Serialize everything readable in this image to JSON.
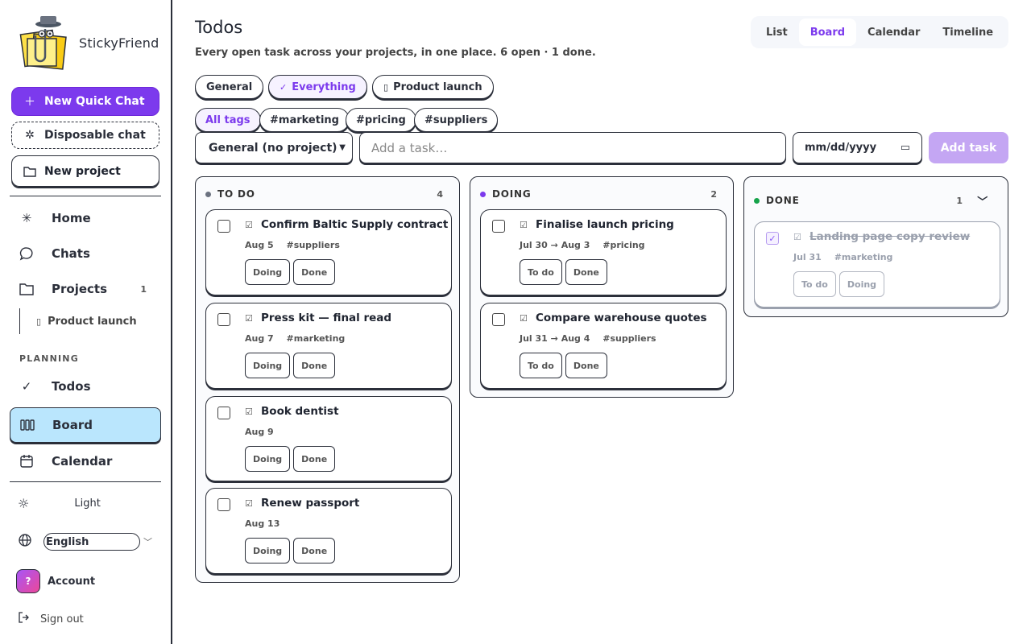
{
  "app": {
    "name": "StickyFriend"
  },
  "sidebar": {
    "new_quick_chat": "New Quick Chat",
    "disposable_chat": "Disposable chat",
    "new_project": "New project",
    "nav": {
      "home": "Home",
      "chats": "Chats",
      "projects": "Projects",
      "projects_count": "1",
      "project_child": "Product launch"
    },
    "planning_label": "PLANNING",
    "planning": {
      "todos": "Todos",
      "board": "Board",
      "calendar": "Calendar"
    },
    "theme": "Light",
    "language": "English",
    "account": "Account",
    "avatar_initial": "?",
    "sign_out": "Sign out"
  },
  "header": {
    "title": "Todos",
    "subtitle": "Every open task across your projects, in one place. 6 open · 1 done."
  },
  "views": {
    "list": "List",
    "board": "Board",
    "calendar": "Calendar",
    "timeline": "Timeline",
    "active": "Board"
  },
  "project_filters": {
    "general": "General",
    "everything": "Everything",
    "product_launch": "Product launch"
  },
  "tag_filters": {
    "all": "All tags",
    "marketing": "#marketing",
    "pricing": "#pricing",
    "suppliers": "#suppliers"
  },
  "composer": {
    "project_select": "General (no project)",
    "task_placeholder": "Add a task…",
    "date_placeholder": "mm/dd/yyyy",
    "add_button": "Add task"
  },
  "colors": {
    "accent": "#7c3aed",
    "todo_dot": "#6b7280",
    "doing_dot": "#7c3aed",
    "done_dot": "#16a34a",
    "active_nav": "#bae6fd"
  },
  "columns": {
    "todo": {
      "label": "TO DO",
      "count": "4",
      "cards": [
        {
          "title": "Confirm Baltic Supply contract",
          "date": "Aug 5",
          "tag": "#suppliers",
          "action1": "Doing",
          "action2": "Done"
        },
        {
          "title": "Press kit — final read",
          "date": "Aug 7",
          "tag": "#marketing",
          "action1": "Doing",
          "action2": "Done"
        },
        {
          "title": "Book dentist",
          "date": "Aug 9",
          "tag": "",
          "action1": "Doing",
          "action2": "Done"
        },
        {
          "title": "Renew passport",
          "date": "Aug 13",
          "tag": "",
          "action1": "Doing",
          "action2": "Done"
        }
      ]
    },
    "doing": {
      "label": "DOING",
      "count": "2",
      "cards": [
        {
          "title": "Finalise launch pricing",
          "date": "Jul 30 → Aug 3",
          "tag": "#pricing",
          "action1": "To do",
          "action2": "Done"
        },
        {
          "title": "Compare warehouse quotes",
          "date": "Jul 31 → Aug 4",
          "tag": "#suppliers",
          "action1": "To do",
          "action2": "Done"
        }
      ]
    },
    "done": {
      "label": "DONE",
      "count": "1",
      "cards": [
        {
          "title": "Landing page copy review",
          "date": "Jul 31",
          "tag": "#marketing",
          "action1": "To do",
          "action2": "Doing"
        }
      ]
    }
  }
}
